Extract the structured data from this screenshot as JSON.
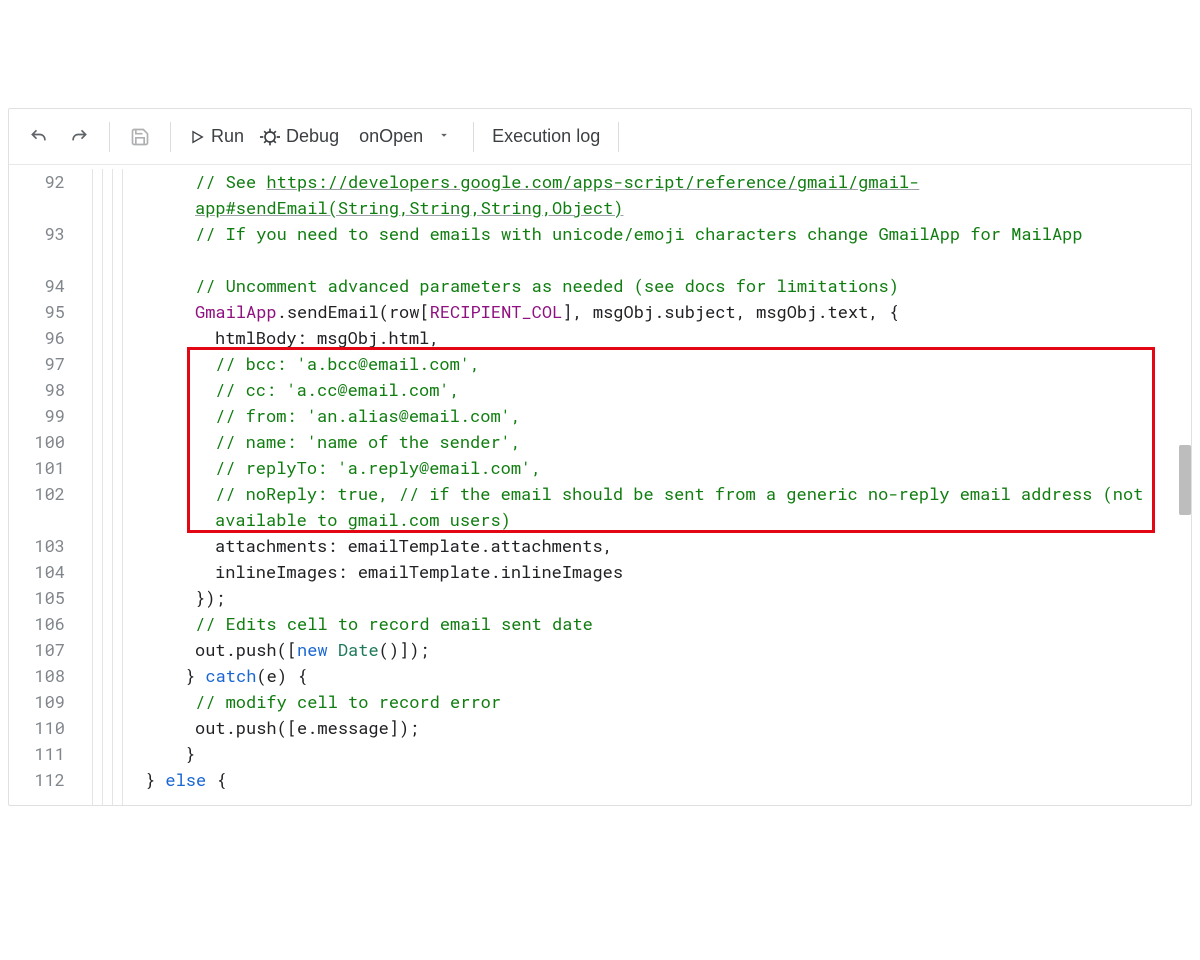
{
  "toolbar": {
    "run": "Run",
    "debug": "Debug",
    "func": "onOpen",
    "exec_log": "Execution log"
  },
  "line_numbers": [
    "92",
    "93",
    "94",
    "95",
    "96",
    "97",
    "98",
    "99",
    "100",
    "101",
    "102",
    "103",
    "104",
    "105",
    "106",
    "107",
    "108",
    "109",
    "110",
    "111",
    "112"
  ],
  "tall_lines": [
    "92",
    "93",
    "102"
  ],
  "code": {
    "l92a": "// See ",
    "l92b": "https://developers.google.com/apps-script/reference/gmail/gmail-app#sendEmail(String,String,String,Object)",
    "l93": "// If you need to send emails with unicode/emoji characters change GmailApp for MailApp",
    "l94": "// Uncomment advanced parameters as needed (see docs for limitations)",
    "l95_class": "GmailApp",
    "l95_mid1": ".sendEmail(row[",
    "l95_recip": "RECIPIENT_COL",
    "l95_mid2": "], msgObj.subject, msgObj.text, {",
    "l96": "htmlBody: msgObj.html,",
    "l97": "// bcc: 'a.bcc@email.com',",
    "l98": "// cc: 'a.cc@email.com',",
    "l99": "// from: 'an.alias@email.com',",
    "l100": "// name: 'name of the sender',",
    "l101": "// replyTo: 'a.reply@email.com',",
    "l102": "// noReply: true, // if the email should be sent from a generic no-reply email address (not available to gmail.com users)",
    "l103": "attachments: emailTemplate.attachments,",
    "l104": "inlineImages: emailTemplate.inlineImages",
    "l105": "});",
    "l106": "// Edits cell to record email sent date",
    "l107_a": "out.push([",
    "l107_new": "new",
    "l107_sp": " ",
    "l107_date": "Date",
    "l107_b": "()]);",
    "l108_a": "} ",
    "l108_catch": "catch",
    "l108_b": "(e) {",
    "l109": "// modify cell to record error",
    "l110": "out.push([e.message]);",
    "l111": "}",
    "l112_a": "} ",
    "l112_else": "else",
    "l112_b": " {"
  }
}
